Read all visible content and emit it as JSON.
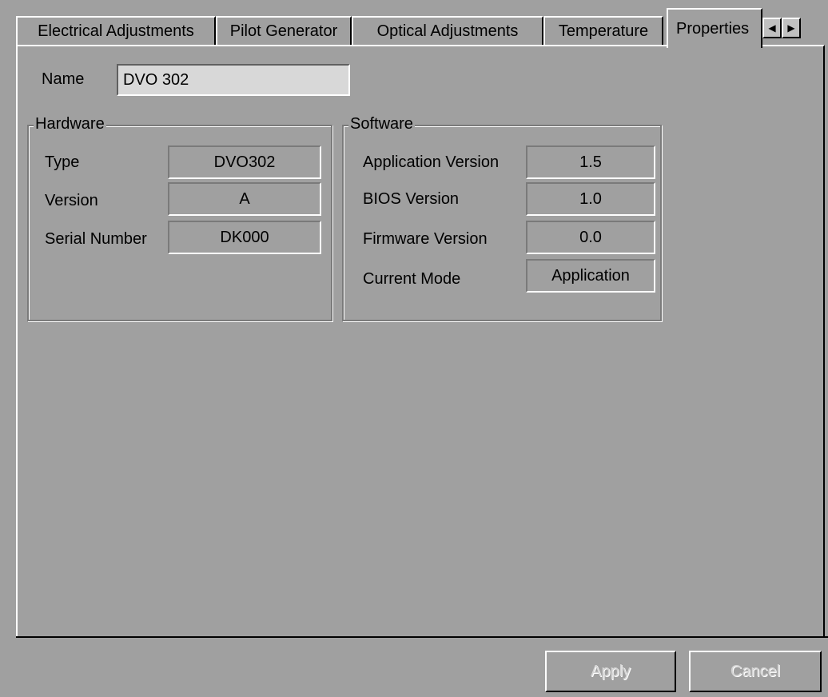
{
  "tabs": [
    {
      "label": "Electrical Adjustments"
    },
    {
      "label": "Pilot Generator"
    },
    {
      "label": "Optical Adjustments"
    },
    {
      "label": "Temperature"
    },
    {
      "label": "Properties"
    }
  ],
  "scroll": {
    "left_icon": "left-arrow-icon",
    "right_icon": "right-arrow-icon",
    "left_glyph": "◀",
    "right_glyph": "▶"
  },
  "name": {
    "label": "Name",
    "value": "DVO 302"
  },
  "hardware": {
    "title": "Hardware",
    "rows": [
      {
        "label": "Type",
        "value": "DVO302"
      },
      {
        "label": "Version",
        "value": "A"
      },
      {
        "label": "Serial Number",
        "value": "DK000"
      }
    ]
  },
  "software": {
    "title": "Software",
    "rows": [
      {
        "label": "Application Version",
        "value": "1.5"
      },
      {
        "label": "BIOS Version",
        "value": "1.0"
      },
      {
        "label": "Firmware Version",
        "value": "0.0"
      },
      {
        "label": "Current Mode",
        "value": "Application"
      }
    ]
  },
  "buttons": {
    "apply": "Apply",
    "cancel": "Cancel"
  }
}
